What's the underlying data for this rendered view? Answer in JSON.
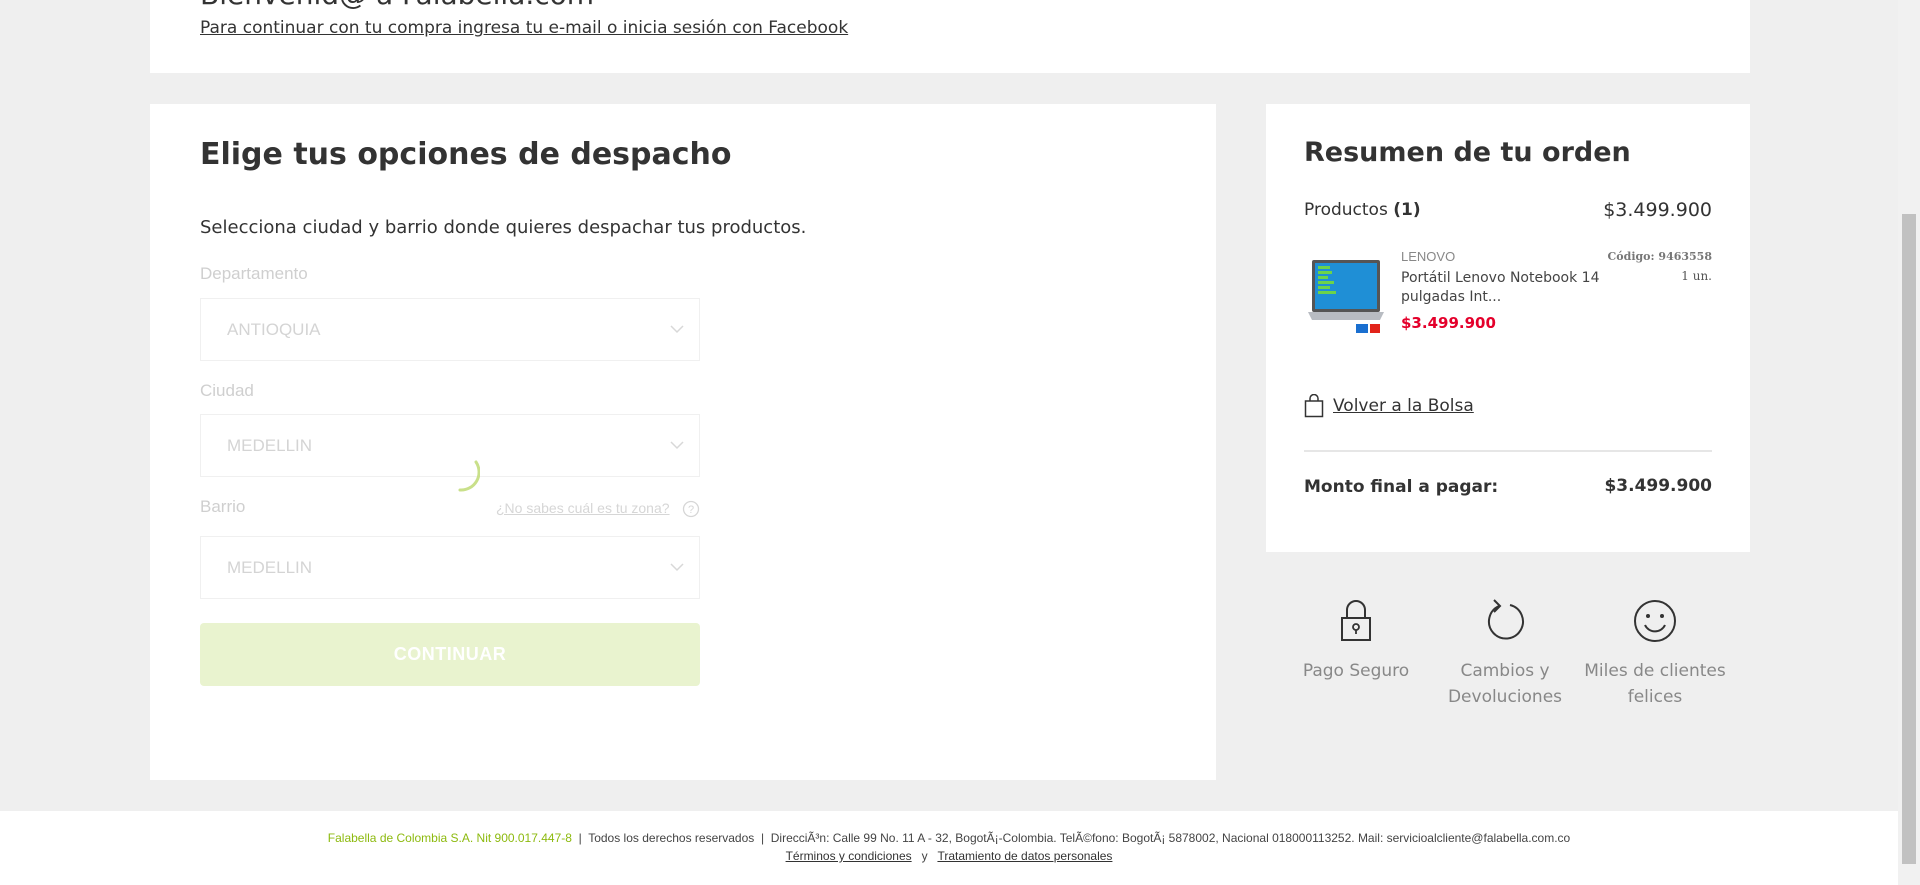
{
  "login": {
    "title": "Bienvenid@ a Falabella.com",
    "link": "Para continuar con tu compra ingresa tu e-mail o inicia sesión con Facebook"
  },
  "dispatch": {
    "title": "Elige tus opciones de despacho",
    "subtitle": "Selecciona ciudad y barrio donde quieres despachar tus productos.",
    "departamento": {
      "label": "Departamento",
      "value": "ANTIOQUIA"
    },
    "ciudad": {
      "label": "Ciudad",
      "value": "MEDELLIN"
    },
    "barrio": {
      "label": "Barrio",
      "value": "MEDELLIN"
    },
    "zone_help": "¿No sabes cuál es tu zona?",
    "continue": "CONTINUAR"
  },
  "summary": {
    "title": "Resumen de tu orden",
    "products_label": "Productos",
    "products_count": "(1)",
    "products_total": "$3.499.900",
    "product": {
      "brand": "LENOVO",
      "name": "Portátil Lenovo Notebook 14 pulgadas Int...",
      "price": "$3.499.900",
      "code": "Código: 9463558",
      "qty": "1 un."
    },
    "back_to_bag": "Volver a la Bolsa",
    "final_label": "Monto final a pagar:",
    "final_value": "$3.499.900"
  },
  "trust": [
    {
      "icon": "lock-icon",
      "label": "Pago Seguro"
    },
    {
      "icon": "refresh-icon",
      "label": "Cambios y Devoluciones"
    },
    {
      "icon": "smile-icon",
      "label": "Miles de clientes felices"
    }
  ],
  "footer": {
    "company": "Falabella de Colombia S.A. Nit 900.017.447-8",
    "rights": "Todos los derechos reservados",
    "address": "DirecciÃ³n: Calle 99 No. 11 A - 32, BogotÃ¡-Colombia. TelÃ©fono: BogotÃ¡ 5878002, Nacional 018000113252. Mail: servicioalcliente@falabella.com.co",
    "terms": "Términos y condiciones",
    "and": "y",
    "privacy": "Tratamiento de datos personales"
  },
  "colors": {
    "accent_green": "#8dba0f",
    "price_red": "#e4002b",
    "disabled_button": "#e9f3cf"
  }
}
